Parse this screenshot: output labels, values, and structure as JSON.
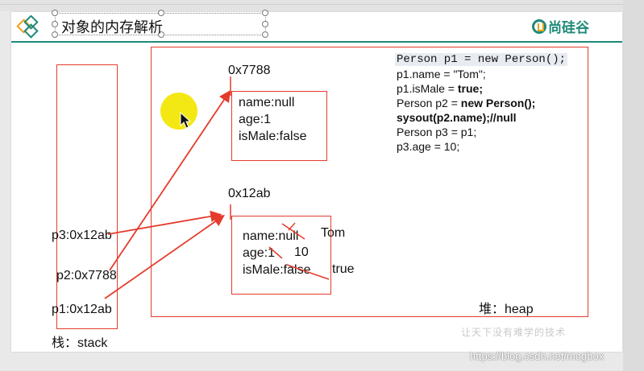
{
  "slide": {
    "title": "对象的内存解析",
    "brand": "尚硅谷"
  },
  "heap": {
    "label": "堆：heap",
    "object1": {
      "address": "0x7788",
      "fields": [
        "name:null",
        "age:1",
        "isMale:false"
      ]
    },
    "object2": {
      "address": "0x12ab",
      "fields": [
        "name:null",
        "age:1",
        "isMale:false"
      ],
      "new_name": "Tom",
      "new_age": "10",
      "new_is_male": "true"
    }
  },
  "stack": {
    "label": "栈：stack",
    "vars": [
      "p3:0x12ab",
      "p2:0x7788",
      "p1:0x12ab"
    ]
  },
  "code": {
    "line1": "Person p1 = new Person();",
    "line2": "p1.name = \"Tom\";",
    "line3_pre": "p1.isMale = ",
    "line3_kw": "true;",
    "line4_pre": "Person p2 = ",
    "line4_kw": "new Person();",
    "line5": "sysout(p2.name);//null",
    "line6": "Person p3 = p1;",
    "line7": "p3.age = 10;"
  },
  "watermark": "让天下没有难学的技术",
  "url": "https://blog.csdn.net/mogbox",
  "colors": {
    "accent": "#1f8a7a",
    "arrow": "#e53b2c",
    "brand_orange": "#e8a31a",
    "highlight": "#f2e600"
  }
}
